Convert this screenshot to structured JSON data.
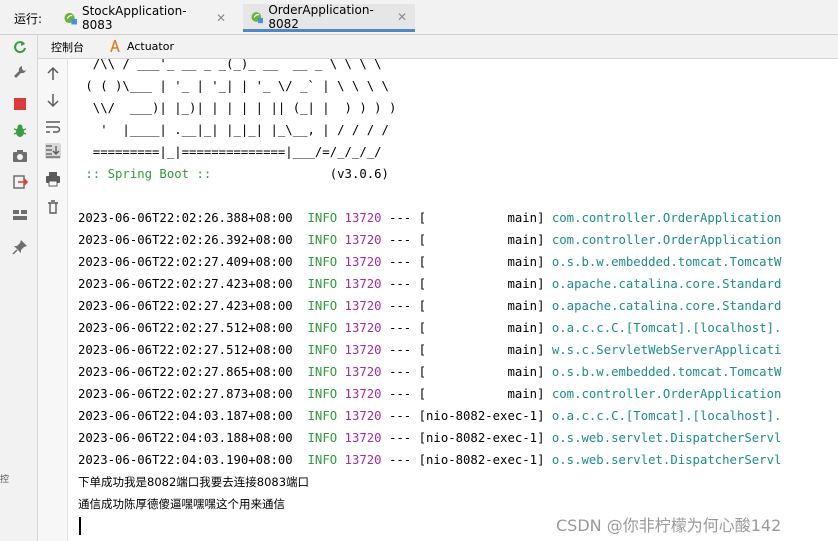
{
  "run_label": "运行:",
  "tabs": [
    {
      "label": "StockApplication-8083",
      "active": false
    },
    {
      "label": "OrderApplication-8082",
      "active": true
    }
  ],
  "subtabs": {
    "console": "控制台",
    "actuator": "Actuator"
  },
  "banner": [
    "  /\\\\ / ___'_ __ _ _(_)_ __  __ _ \\ \\ \\ \\",
    " ( ( )\\___ | '_ | '_| | '_ \\/ _` | \\ \\ \\ \\",
    "  \\\\/  ___)| |_)| | | | | || (_| |  ) ) ) )",
    "   '  |____| .__|_| |_|_| |_\\__, | / / / /",
    "  =========|_|==============|___/=/_/_/_/"
  ],
  "spring_boot": {
    "label": " :: Spring Boot :: ",
    "version": "(v3.0.6)"
  },
  "logs": [
    {
      "ts": "2023-06-06T22:02:26.388+08:00",
      "level": "INFO",
      "pid": "13720",
      "thread": "[           main]",
      "logger": "com.controller.OrderApplication"
    },
    {
      "ts": "2023-06-06T22:02:26.392+08:00",
      "level": "INFO",
      "pid": "13720",
      "thread": "[           main]",
      "logger": "com.controller.OrderApplication"
    },
    {
      "ts": "2023-06-06T22:02:27.409+08:00",
      "level": "INFO",
      "pid": "13720",
      "thread": "[           main]",
      "logger": "o.s.b.w.embedded.tomcat.TomcatW"
    },
    {
      "ts": "2023-06-06T22:02:27.423+08:00",
      "level": "INFO",
      "pid": "13720",
      "thread": "[           main]",
      "logger": "o.apache.catalina.core.Standard"
    },
    {
      "ts": "2023-06-06T22:02:27.423+08:00",
      "level": "INFO",
      "pid": "13720",
      "thread": "[           main]",
      "logger": "o.apache.catalina.core.Standard"
    },
    {
      "ts": "2023-06-06T22:02:27.512+08:00",
      "level": "INFO",
      "pid": "13720",
      "thread": "[           main]",
      "logger": "o.a.c.c.C.[Tomcat].[localhost]."
    },
    {
      "ts": "2023-06-06T22:02:27.512+08:00",
      "level": "INFO",
      "pid": "13720",
      "thread": "[           main]",
      "logger": "w.s.c.ServletWebServerApplicati"
    },
    {
      "ts": "2023-06-06T22:02:27.865+08:00",
      "level": "INFO",
      "pid": "13720",
      "thread": "[           main]",
      "logger": "o.s.b.w.embedded.tomcat.TomcatW"
    },
    {
      "ts": "2023-06-06T22:02:27.873+08:00",
      "level": "INFO",
      "pid": "13720",
      "thread": "[           main]",
      "logger": "com.controller.OrderApplication"
    },
    {
      "ts": "2023-06-06T22:04:03.187+08:00",
      "level": "INFO",
      "pid": "13720",
      "thread": "[nio-8082-exec-1]",
      "logger": "o.a.c.c.C.[Tomcat].[localhost]."
    },
    {
      "ts": "2023-06-06T22:04:03.188+08:00",
      "level": "INFO",
      "pid": "13720",
      "thread": "[nio-8082-exec-1]",
      "logger": "o.s.web.servlet.DispatcherServl"
    },
    {
      "ts": "2023-06-06T22:04:03.190+08:00",
      "level": "INFO",
      "pid": "13720",
      "thread": "[nio-8082-exec-1]",
      "logger": "o.s.web.servlet.DispatcherServl"
    }
  ],
  "output_lines": [
    "下单成功我是8082端口我要去连接8083端口",
    "通信成功陈厚德傻逼嘿嘿嘿这个用来通信"
  ],
  "watermark": "CSDN @你非柠檬为何心酸142",
  "edge_text": "控"
}
